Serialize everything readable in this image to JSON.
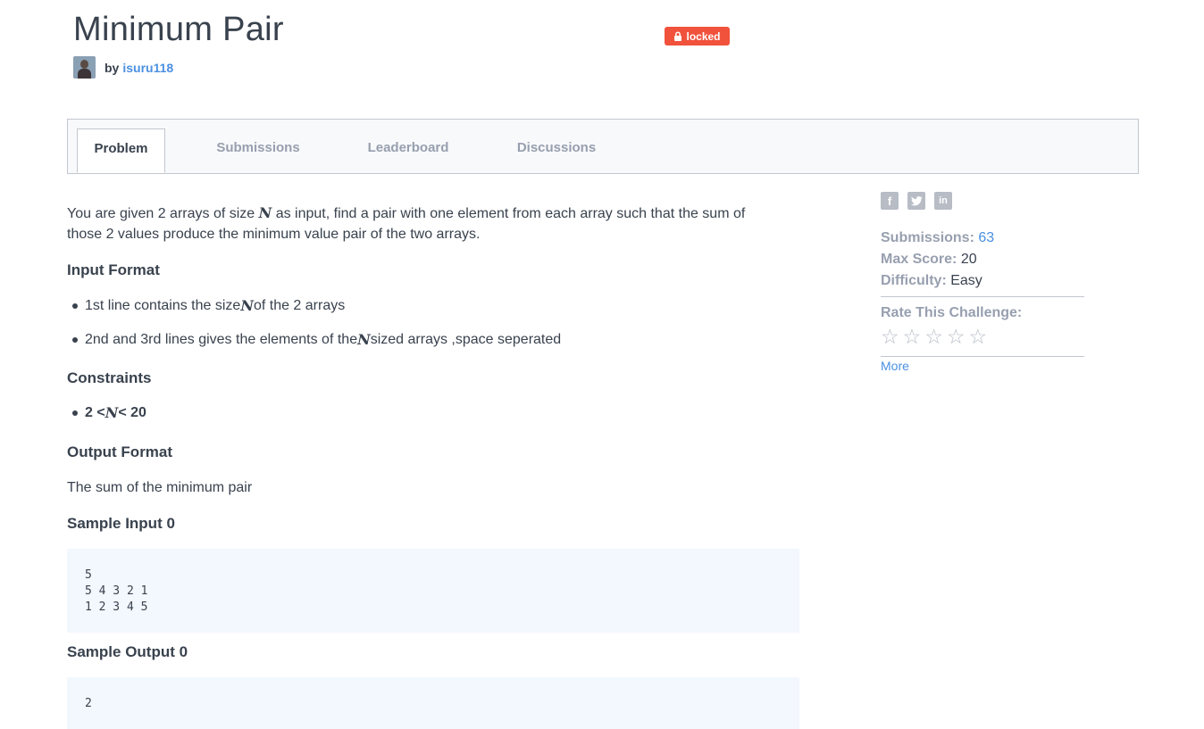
{
  "challenge": {
    "title": "Minimum Pair",
    "badge": "locked",
    "by_label": "by",
    "author": "isuru118"
  },
  "tabs": [
    "Problem",
    "Submissions",
    "Leaderboard",
    "Discussions"
  ],
  "problem": {
    "intro_a": "You are given 2 arrays of size ",
    "intro_var": "N",
    "intro_b": " as input, find a pair with one element from each array such that the sum of",
    "intro_c": "those 2 values produce the minimum value pair of the two arrays.",
    "input_heading": "Input Format",
    "input_items": [
      {
        "before": "1st line contains the size ",
        "var": "N",
        "after": " of the 2 arrays"
      },
      {
        "before": "2nd and 3rd lines gives the elements of the ",
        "var": "N",
        "after": " sized arrays ,space seperated"
      }
    ],
    "constraints_heading": "Constraints",
    "constraint": {
      "before": "2 < ",
      "var": "N",
      "after": " < 20"
    },
    "output_heading": "Output Format",
    "output_text": "The sum of the minimum pair",
    "sample_input_heading": "Sample Input 0",
    "sample_input": "5\n5 4 3 2 1\n1 2 3 4 5",
    "sample_output_heading": "Sample Output 0",
    "sample_output": "2"
  },
  "sidebar": {
    "share_icons": [
      "facebook-icon",
      "twitter-icon",
      "linkedin-icon"
    ],
    "submissions_label": "Submissions:",
    "submissions_value": "63",
    "max_score_label": "Max Score:",
    "max_score_value": "20",
    "difficulty_label": "Difficulty:",
    "difficulty_value": "Easy",
    "rate_label": "Rate This Challenge:",
    "rating_stars": 5,
    "more_label": "More"
  },
  "colors": {
    "accent": "#4a90e2",
    "locked": "#f1523c",
    "text": "#39424e",
    "muted": "#979faf",
    "code_bg": "#f3f7fe"
  }
}
